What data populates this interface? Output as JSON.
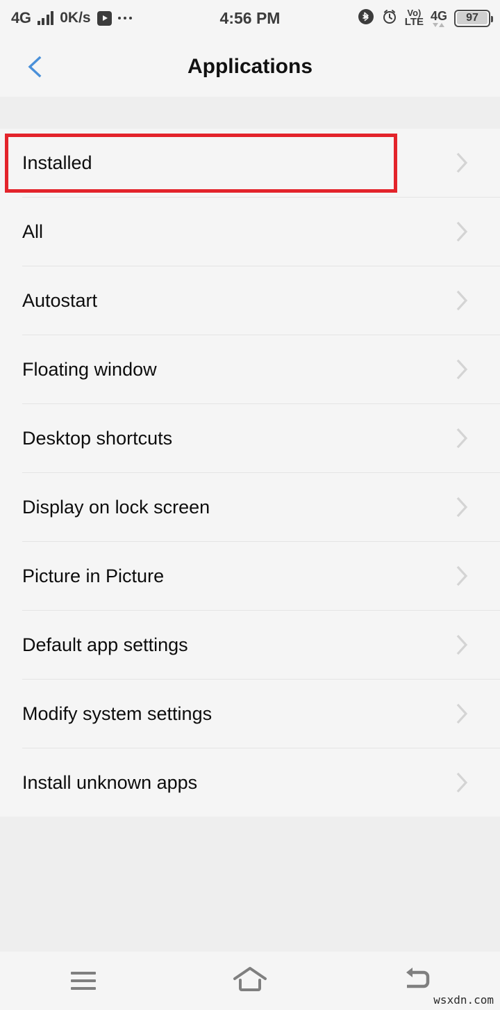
{
  "status_bar": {
    "network_type": "4G",
    "signal_icon": "signal-bars-icon",
    "data_speed": "0K/s",
    "play_icon": "play-icon",
    "more_icon": "more-dots-icon",
    "clock": "4:56 PM",
    "bluetooth_icon": "bluetooth-icon",
    "alarm_icon": "alarm-clock-icon",
    "volte_line1": "Vo)",
    "volte_line2": "LTE",
    "mobile_data_label": "4G",
    "data_arrows_icon": "data-transfer-arrows-icon",
    "battery_percent": "97"
  },
  "header": {
    "back_icon": "back-chevron-icon",
    "title": "Applications"
  },
  "list": {
    "items": [
      {
        "label": "Installed",
        "chevron": "chevron-right-icon",
        "highlighted": true
      },
      {
        "label": "All",
        "chevron": "chevron-right-icon",
        "highlighted": false
      },
      {
        "label": "Autostart",
        "chevron": "chevron-right-icon",
        "highlighted": false
      },
      {
        "label": "Floating window",
        "chevron": "chevron-right-icon",
        "highlighted": false
      },
      {
        "label": "Desktop shortcuts",
        "chevron": "chevron-right-icon",
        "highlighted": false
      },
      {
        "label": "Display on lock screen",
        "chevron": "chevron-right-icon",
        "highlighted": false
      },
      {
        "label": "Picture in Picture",
        "chevron": "chevron-right-icon",
        "highlighted": false
      },
      {
        "label": "Default app settings",
        "chevron": "chevron-right-icon",
        "highlighted": false
      },
      {
        "label": "Modify system settings",
        "chevron": "chevron-right-icon",
        "highlighted": false
      },
      {
        "label": "Install unknown apps",
        "chevron": "chevron-right-icon",
        "highlighted": false
      }
    ],
    "highlight_color": "#e3242b"
  },
  "nav_bar": {
    "menu_icon": "menu-hamburger-icon",
    "home_icon": "home-icon",
    "back_icon": "back-arrow-icon"
  },
  "watermark": "wsxdn.com",
  "colors": {
    "panel": "#f5f5f5",
    "page_background": "#eeeeee",
    "accent_blue": "#4a90d9",
    "highlight_red": "#e3242b",
    "divider": "#e4e4e4",
    "chevron_gray": "#d4d4d4"
  }
}
